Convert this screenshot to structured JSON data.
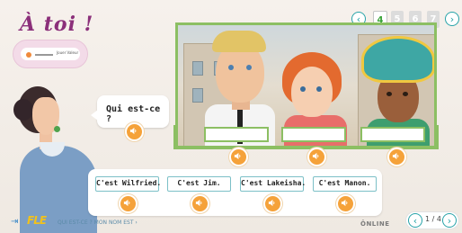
{
  "title": "À toi !",
  "instruction_thumb_text": "Jouer Valeur",
  "pager": {
    "prev": "‹",
    "next": "›",
    "pages": [
      "4",
      "5",
      "6",
      "7"
    ],
    "active_index": 0
  },
  "speech": {
    "question": "Qui est-ce ?"
  },
  "answers": [
    {
      "label": "C'est Wilfried."
    },
    {
      "label": "C'est Jim."
    },
    {
      "label": "C'est Lakeisha."
    },
    {
      "label": "C'est Manon."
    }
  ],
  "footer": {
    "logo": "FLE",
    "breadcrumb": "QUI EST-CE ? MON NOM EST ›",
    "brand": "ÔNLINE",
    "page_indicator": "1 / 4",
    "prev": "‹",
    "next": "›"
  },
  "colors": {
    "title": "#8b2f7a",
    "accent_green": "#8cbf63",
    "audio": "#f5a23a",
    "teal": "#27a3a8"
  }
}
